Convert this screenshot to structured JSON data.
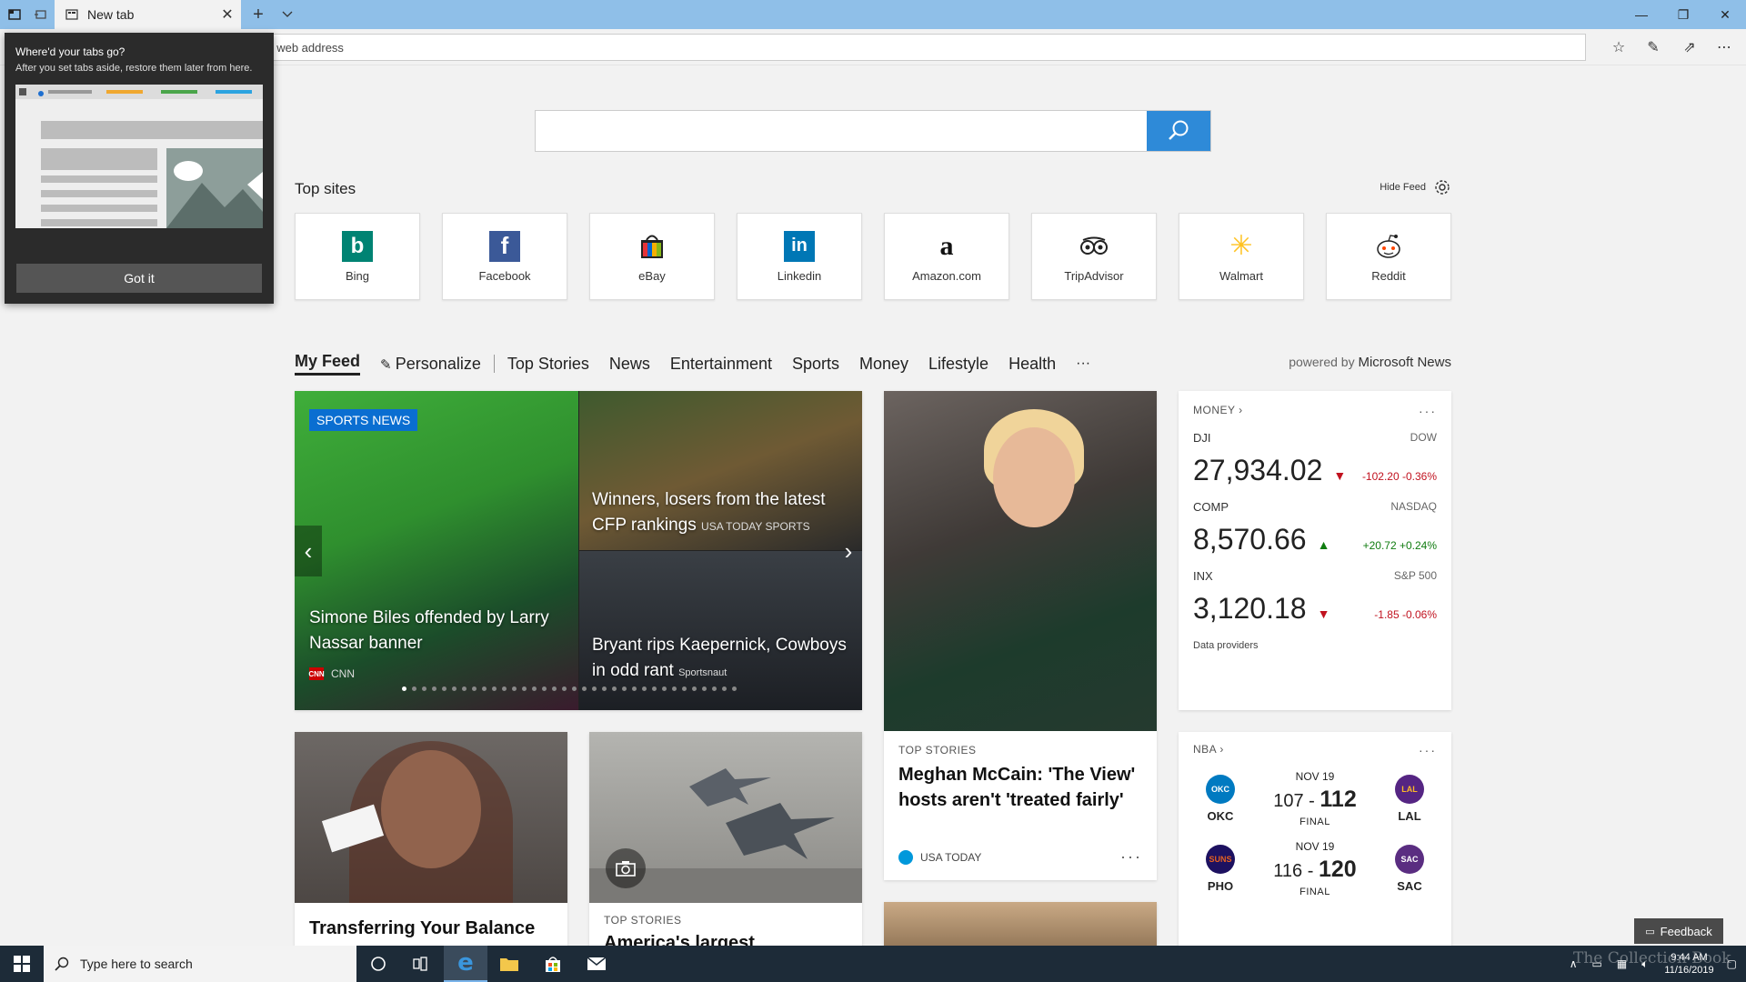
{
  "browser": {
    "tab_title": "New tab",
    "address_placeholder": "Search or enter web address"
  },
  "search": {
    "placeholder": ""
  },
  "top_sites": {
    "title": "Top sites",
    "hide_feed": "Hide Feed",
    "sites": [
      {
        "label": "Bing",
        "icon": "bing-icon",
        "color": "#008373"
      },
      {
        "label": "Facebook",
        "icon": "facebook-icon",
        "color": "#3b5998"
      },
      {
        "label": "eBay",
        "icon": "ebay-icon",
        "color": "#e53238"
      },
      {
        "label": "Linkedin",
        "icon": "linkedin-icon",
        "color": "#0077b5"
      },
      {
        "label": "Amazon.com",
        "icon": "amazon-icon",
        "color": "#111111"
      },
      {
        "label": "TripAdvisor",
        "icon": "tripadvisor-icon",
        "color": "#222222"
      },
      {
        "label": "Walmart",
        "icon": "walmart-icon",
        "color": "#ffc220"
      },
      {
        "label": "Reddit",
        "icon": "reddit-icon",
        "color": "#ff4500"
      }
    ]
  },
  "feed_nav": {
    "items": [
      "My Feed",
      "Personalize",
      "Top Stories",
      "News",
      "Entertainment",
      "Sports",
      "Money",
      "Lifestyle",
      "Health",
      "···"
    ],
    "powered_prefix": "powered by",
    "powered_brand": "Microsoft News"
  },
  "hero": {
    "badge": "SPORTS NEWS",
    "main_caption": "Simone Biles offended by Larry Nassar banner",
    "main_source": "CNN",
    "top_caption": "Winners, losers from the latest CFP rankings",
    "top_source": "USA TODAY SPORTS",
    "bottom_caption": "Bryant rips Kaepernick, Cowboys in odd rant",
    "bottom_source": "Sportsnaut"
  },
  "portrait_card": {
    "kicker": "TOP STORIES",
    "headline": "Meghan McCain: 'The View' hosts aren't 'treated fairly'",
    "source": "USA TODAY",
    "more": "···"
  },
  "money": {
    "title": "MONEY",
    "more": "···",
    "stocks": [
      {
        "symbol": "DJI",
        "exchange": "DOW",
        "value": "27,934.02",
        "change": "-102.20 -0.36%",
        "direction": "down"
      },
      {
        "symbol": "COMP",
        "exchange": "NASDAQ",
        "value": "8,570.66",
        "change": "+20.72 +0.24%",
        "direction": "up"
      },
      {
        "symbol": "INX",
        "exchange": "S&P 500",
        "value": "3,120.18",
        "change": "-1.85 -0.06%",
        "direction": "down"
      }
    ],
    "data_providers": "Data providers"
  },
  "nba": {
    "title": "NBA",
    "more": "···",
    "games": [
      {
        "date": "NOV 19",
        "home": "OKC",
        "away": "LAL",
        "home_score": "107",
        "away_score": "112",
        "status": "FINAL"
      },
      {
        "date": "NOV 19",
        "home": "PHO",
        "away": "SAC",
        "home_score": "116",
        "away_score": "120",
        "status": "FINAL"
      }
    ]
  },
  "lower_cards": {
    "woman_headline": "Transferring Your Balance To",
    "jets_kicker": "TOP STORIES",
    "jets_headline": "America's largest"
  },
  "popup": {
    "title": "Where'd your tabs go?",
    "text": "After you set tabs aside, restore them later from here.",
    "button": "Got it"
  },
  "feedback": {
    "label": "Feedback"
  },
  "taskbar": {
    "search_placeholder": "Type here to search",
    "time": "9:44 AM",
    "date": "11/16/2019",
    "watermark": "The Collection Book"
  }
}
